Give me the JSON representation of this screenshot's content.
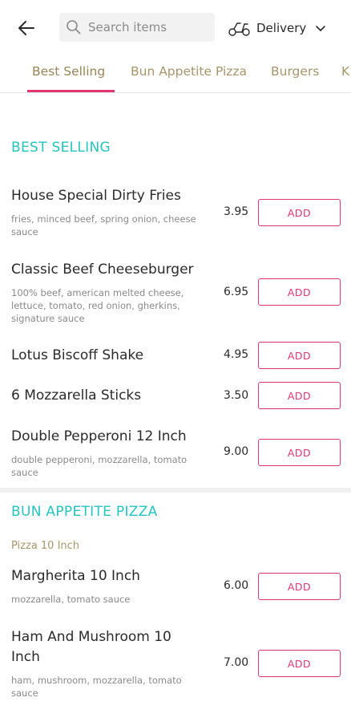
{
  "header": {
    "search_placeholder": "Search items",
    "delivery_label": "Delivery"
  },
  "tabs": [
    {
      "label": "Best Selling"
    },
    {
      "label": "Bun Appetite Pizza"
    },
    {
      "label": "Burgers"
    },
    {
      "label": "K"
    }
  ],
  "sections": {
    "best_selling": {
      "title": "BEST SELLING",
      "items": [
        {
          "name": "House Special Dirty Fries",
          "desc": "fries, minced beef, spring onion, cheese sauce",
          "price": "3.95",
          "button": "ADD"
        },
        {
          "name": "Classic Beef Cheeseburger",
          "desc": "100% beef, american melted cheese, lettuce, tomato, red onion, gherkins, signature sauce",
          "price": "6.95",
          "button": "ADD"
        },
        {
          "name": "Lotus Biscoff Shake",
          "desc": "",
          "price": "4.95",
          "button": "ADD"
        },
        {
          "name": "6 Mozzarella Sticks",
          "desc": "",
          "price": "3.50",
          "button": "ADD"
        },
        {
          "name": "Double Pepperoni 12 Inch",
          "desc": "double pepperoni, mozzarella, tomato sauce",
          "price": "9.00",
          "button": "ADD"
        }
      ]
    },
    "bun_appetite_pizza": {
      "title": "BUN APPETITE PIZZA",
      "subheading": "Pizza 10 Inch",
      "items": [
        {
          "name": "Margherita 10 Inch",
          "desc": "mozzarella, tomato sauce",
          "price": "6.00",
          "button": "ADD"
        },
        {
          "name": "Ham And Mushroom 10 Inch",
          "desc": "ham, mushroom, mozzarella, tomato sauce",
          "price": "7.00",
          "button": "ADD"
        }
      ]
    }
  },
  "colors": {
    "accent": "#e0356f",
    "section_title": "#27c3c3",
    "tab_text": "#a8956a"
  },
  "icons": {
    "back": "arrow-left-icon",
    "search": "search-icon",
    "delivery": "scooter-icon",
    "dropdown": "chevron-down-icon"
  }
}
